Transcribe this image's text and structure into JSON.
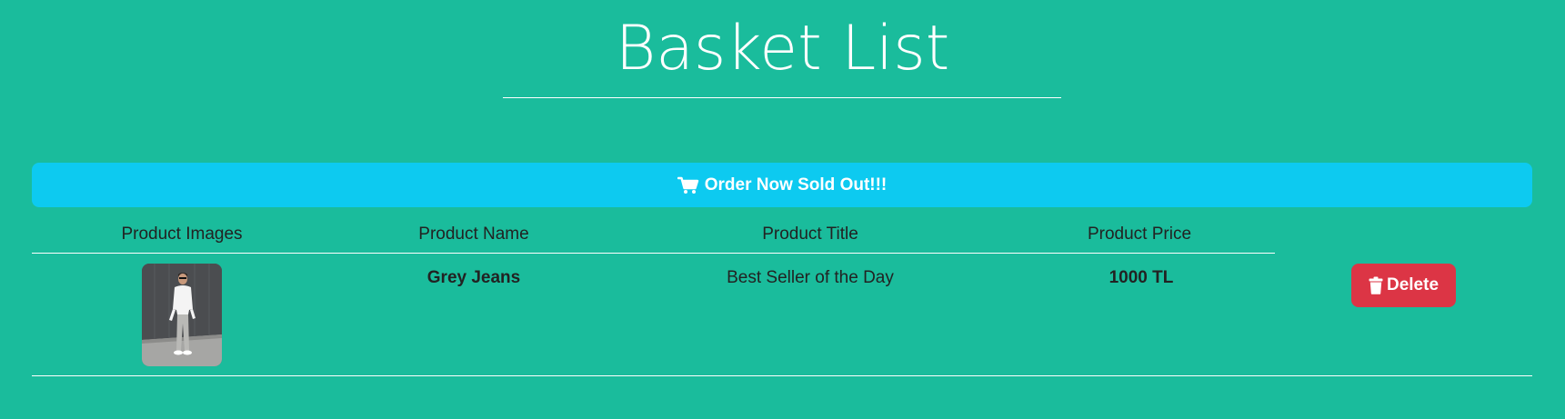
{
  "page": {
    "title": "Basket List"
  },
  "order_bar": {
    "label": "Order Now Sold Out!!!",
    "icon": "cart-icon"
  },
  "table": {
    "columns": [
      "Product Images",
      "Product Name",
      "Product Title",
      "Product Price"
    ],
    "rows": [
      {
        "image": "product-photo",
        "name": "Grey Jeans",
        "title": "Best Seller of the Day",
        "price": "1000 TL",
        "delete_label": "Delete",
        "delete_icon": "trash-icon"
      }
    ]
  },
  "colors": {
    "background": "#1abc9c",
    "order_bar": "#0dcaf0",
    "delete_button": "#dc3545",
    "text": "#222222",
    "rules": "#ffffff"
  }
}
